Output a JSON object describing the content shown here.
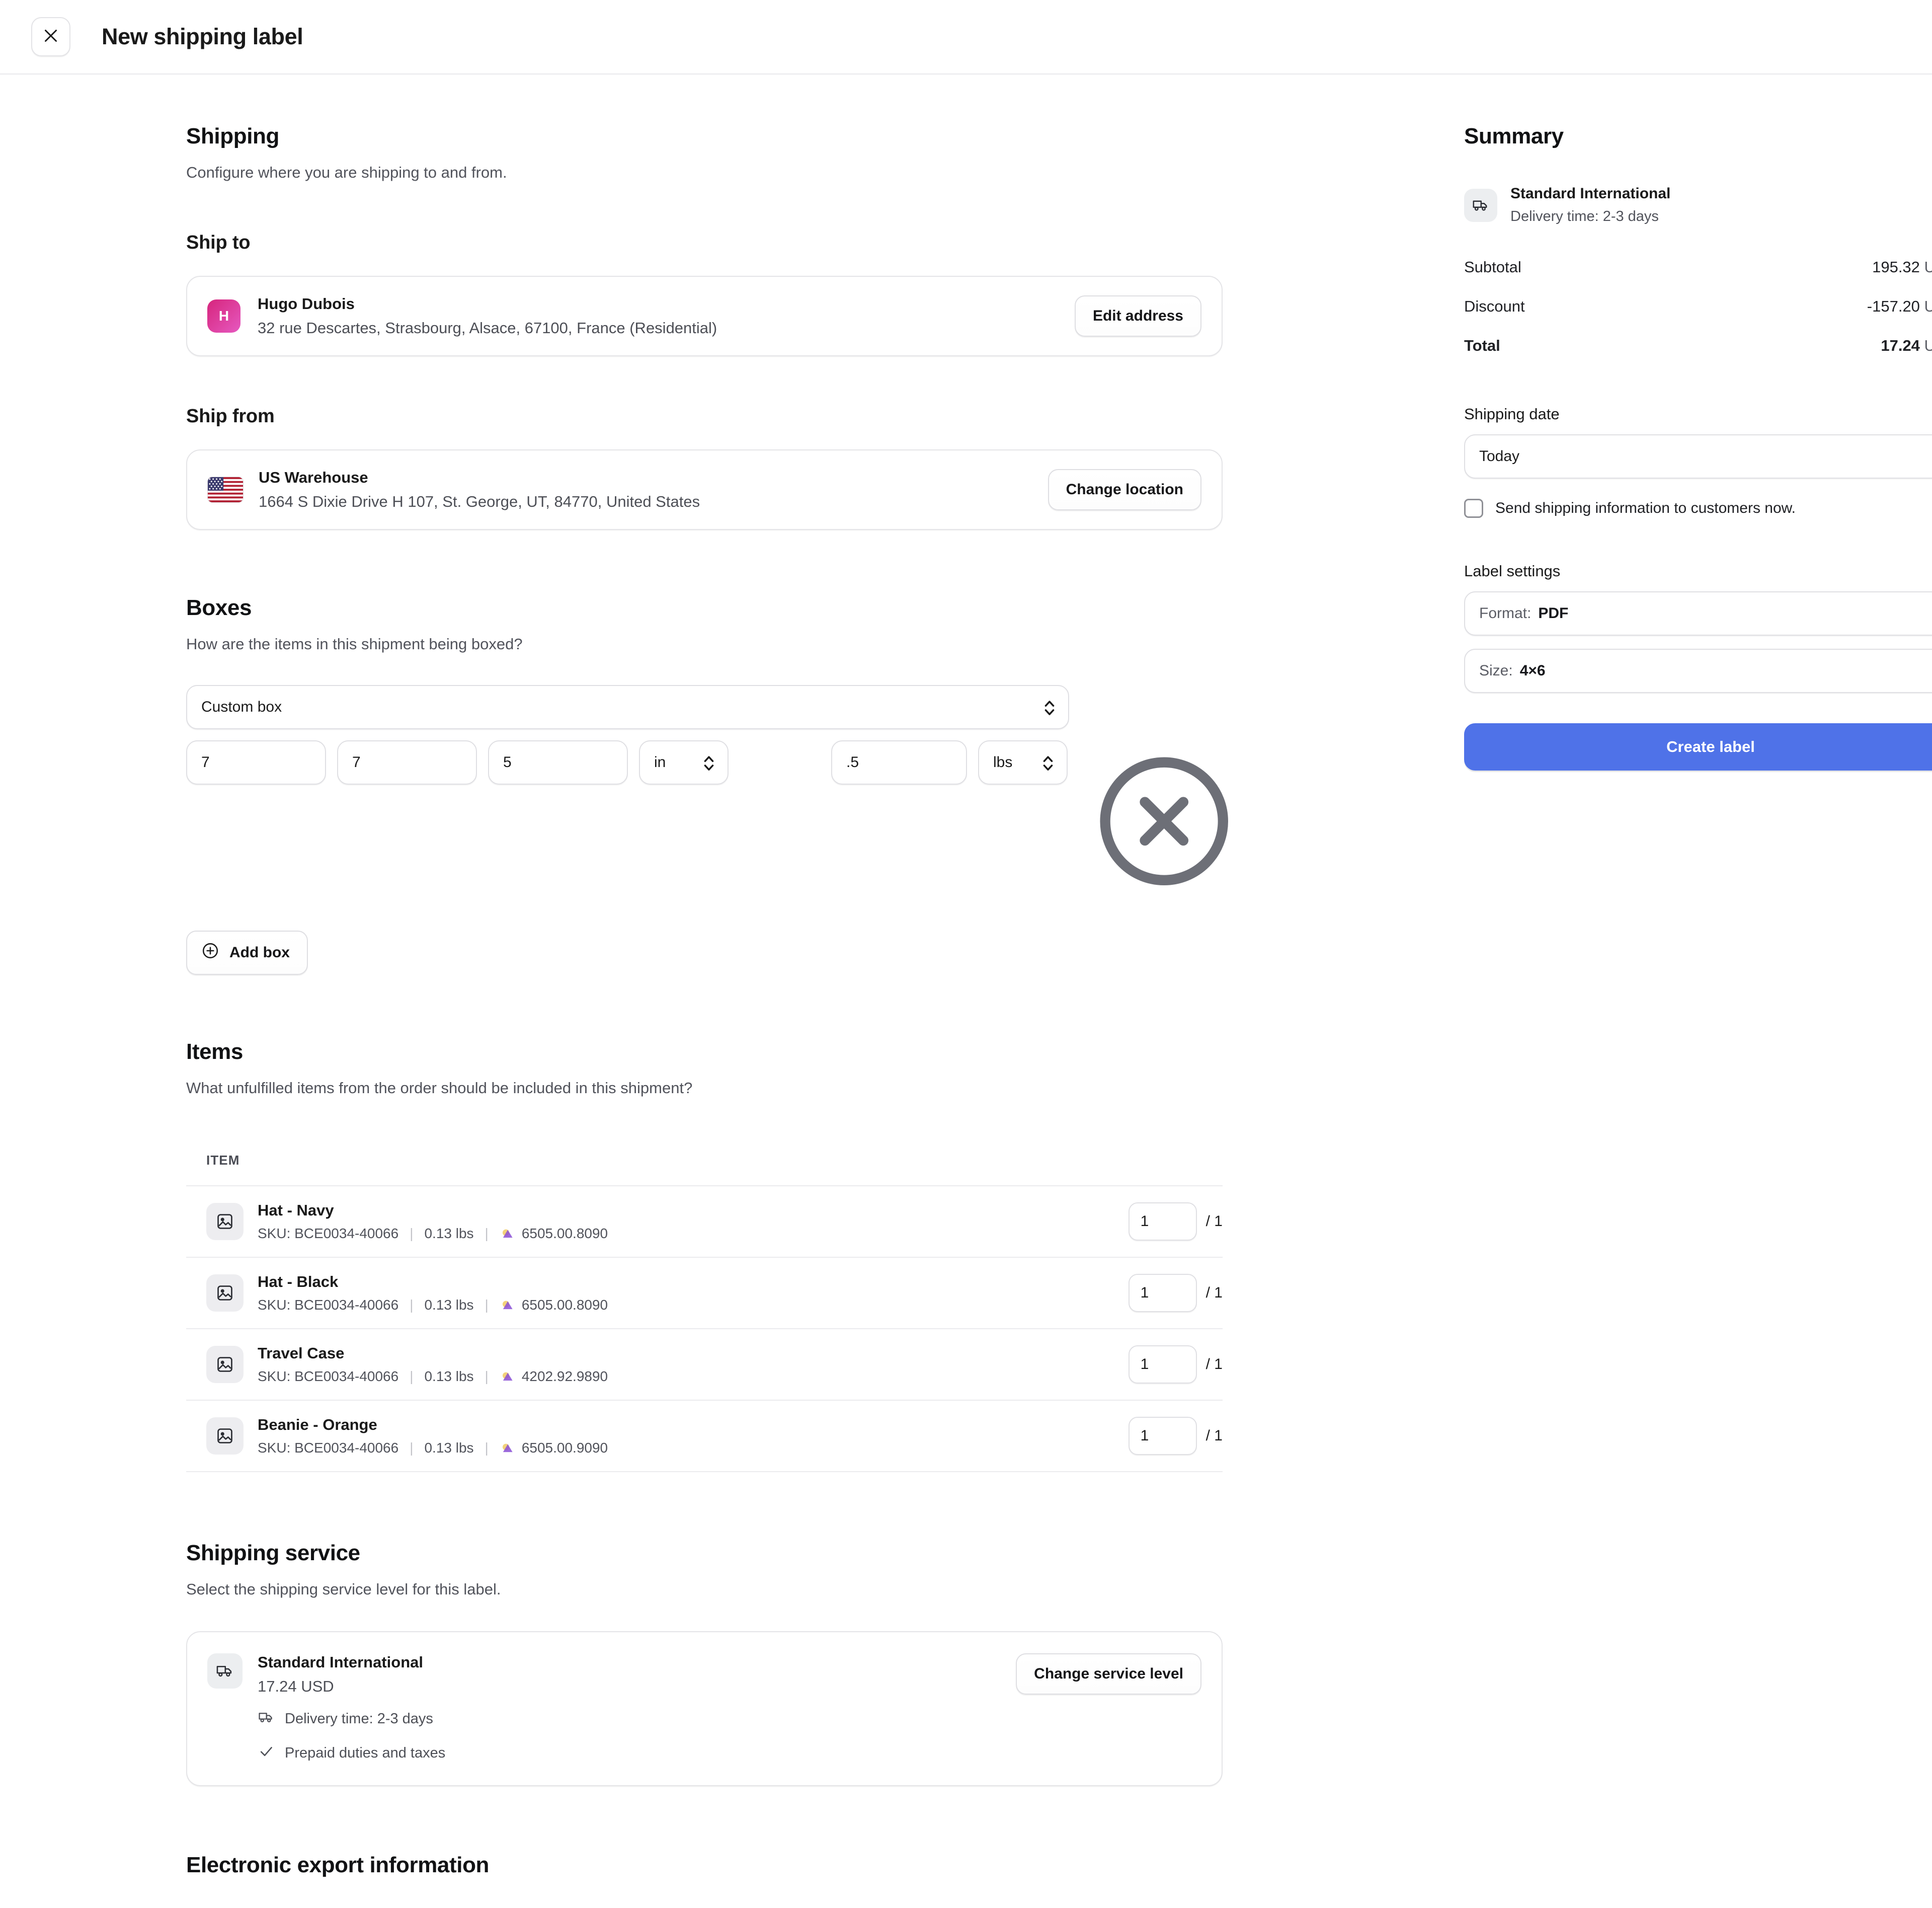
{
  "topbar": {
    "close_icon": "close-icon",
    "title": "New shipping label"
  },
  "shipping": {
    "title": "Shipping",
    "description": "Configure where you are shipping to and from.",
    "ship_to": {
      "label": "Ship to",
      "avatar_initial": "H",
      "name": "Hugo Dubois",
      "address": "32 rue Descartes, Strasbourg, Alsace, 67100, France (Residential)",
      "button": "Edit address"
    },
    "ship_from": {
      "label": "Ship from",
      "flag_icon": "us-flag-icon",
      "name": "US Warehouse",
      "address": "1664 S Dixie Drive H 107, St. George, UT, 84770, United States",
      "button": "Change location"
    }
  },
  "boxes": {
    "title": "Boxes",
    "description": "How are the items in this shipment being boxed?",
    "box_type": "Custom box",
    "length": "7",
    "width": "7",
    "height": "5",
    "dimension_unit": "in",
    "weight": ".5",
    "weight_unit": "lbs",
    "remove_icon": "remove-circle-icon",
    "add_box_label": "Add box",
    "add_icon": "plus-circle-icon"
  },
  "items": {
    "title": "Items",
    "description": "What unfulfilled items from the order should be included in this shipment?",
    "column_header": "ITEM",
    "rows": [
      {
        "name": "Hat - Navy",
        "sku": "SKU: BCE0034-40066",
        "weight": "0.13 lbs",
        "hs_code": "6505.00.8090",
        "qty": "1",
        "qty_total": "/ 1"
      },
      {
        "name": "Hat - Black",
        "sku": "SKU: BCE0034-40066",
        "weight": "0.13 lbs",
        "hs_code": "6505.00.8090",
        "qty": "1",
        "qty_total": "/ 1"
      },
      {
        "name": "Travel Case",
        "sku": "SKU: BCE0034-40066",
        "weight": "0.13 lbs",
        "hs_code": "4202.92.9890",
        "qty": "1",
        "qty_total": "/ 1"
      },
      {
        "name": "Beanie - Orange",
        "sku": "SKU: BCE0034-40066",
        "weight": "0.13 lbs",
        "hs_code": "6505.00.9090",
        "qty": "1",
        "qty_total": "/ 1"
      }
    ]
  },
  "shipping_service": {
    "title": "Shipping service",
    "description": "Select the shipping service level for this label.",
    "service_icon": "delivery-truck-icon",
    "name": "Standard International",
    "price": "17.24 USD",
    "delivery_time": "Delivery time: 2-3 days",
    "prepaid": "Prepaid duties and taxes",
    "button": "Change service level"
  },
  "electronic_export": {
    "title": "Electronic export information"
  },
  "summary": {
    "title": "Summary",
    "service_icon": "delivery-truck-icon",
    "service_name": "Standard International",
    "service_delivery": "Delivery time: 2-3 days",
    "lines": [
      {
        "label": "Subtotal",
        "amount": "195.32",
        "currency": "USD",
        "strong": false
      },
      {
        "label": "Discount",
        "amount": "-157.20",
        "currency": "USD",
        "strong": false
      },
      {
        "label": "Total",
        "amount": "17.24",
        "currency": "USD",
        "strong": true
      }
    ],
    "shipping_date_label": "Shipping date",
    "shipping_date_value": "Today",
    "send_info_label": "Send shipping information to customers now.",
    "label_settings_label": "Label settings",
    "format_prefix": "Format:",
    "format_value": "PDF",
    "size_prefix": "Size:",
    "size_value": "4×6",
    "create_label": "Create label"
  },
  "colors": {
    "primary_button": "#4f72e8",
    "avatar_gradient_start": "#d6257c",
    "avatar_gradient_end": "#e659c0",
    "text_primary": "#1a1a1a",
    "text_secondary": "#51535b",
    "border": "#e4e4e7"
  }
}
